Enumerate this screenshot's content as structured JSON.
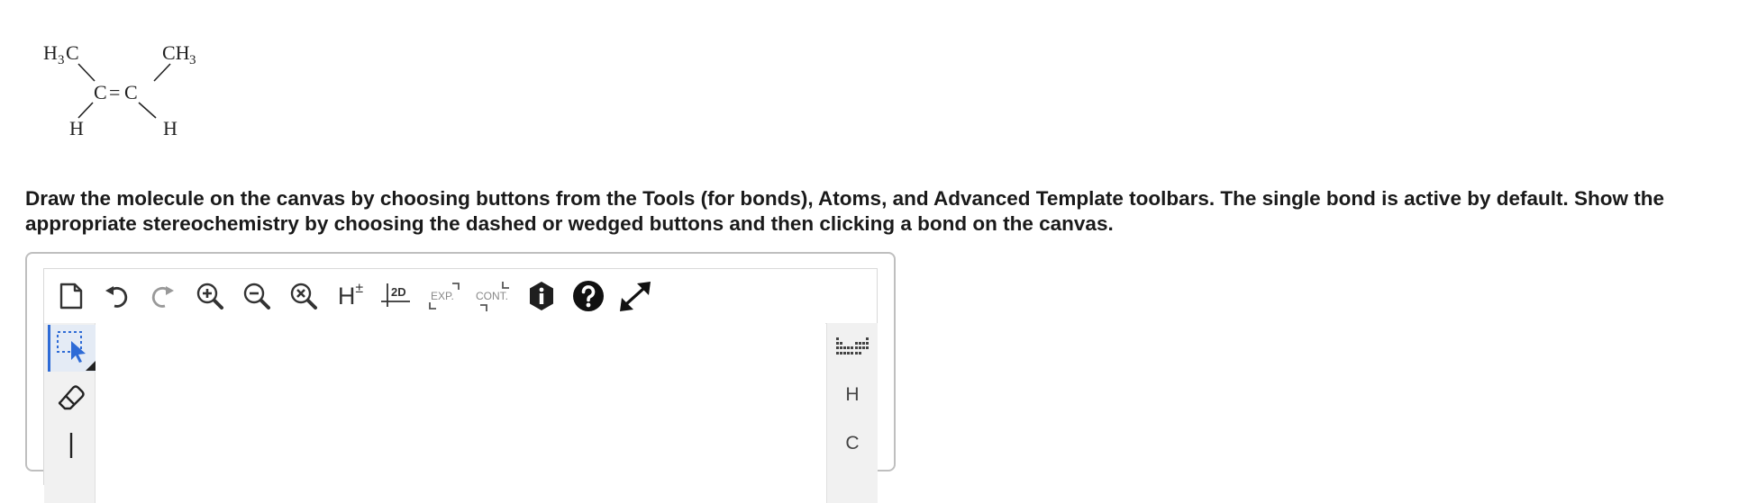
{
  "molecule": {
    "atoms": {
      "top_left": {
        "main": "H",
        "sub": "3",
        "tail": "C"
      },
      "top_right": {
        "main": "CH",
        "sub": "3"
      },
      "carbon_left": "C",
      "double_bond": "=",
      "carbon_right": "C",
      "bottom_left": "H",
      "bottom_right": "H"
    }
  },
  "instructions": "Draw the molecule on the canvas by choosing buttons from the Tools (for bonds), Atoms, and Advanced Template toolbars. The single bond is active by default. Show the appropriate stereochemistry by choosing the dashed or wedged buttons and then clicking a bond on the canvas.",
  "top_toolbar": {
    "hydrogen_toggle": {
      "main": "H",
      "mark": "±"
    },
    "layout_2d": "2D",
    "expand": "EXP.",
    "contract": "CONT."
  },
  "right_toolbar": {
    "atoms": [
      "H",
      "C"
    ]
  },
  "colors": {
    "accent": "#2e6bd6",
    "toolbar_bg": "#f1f1f1",
    "frame_border": "#bfbfbf"
  }
}
